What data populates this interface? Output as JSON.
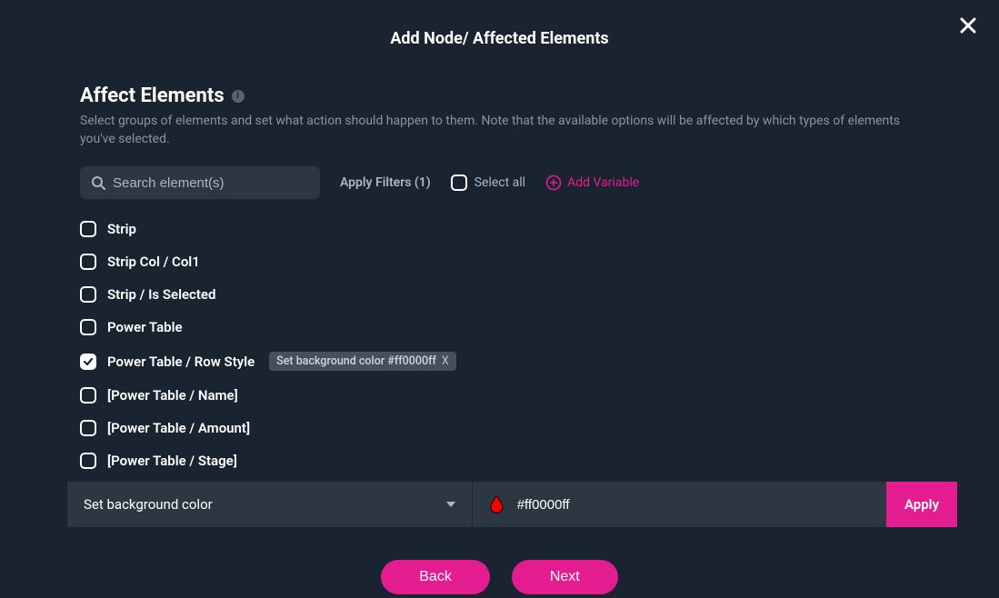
{
  "dialog": {
    "title": "Add Node/ Affected Elements"
  },
  "section": {
    "title": "Affect Elements",
    "desc": "Select groups of elements and set what action should happen to them. Note that the available options will be affected by which types of elements you've selected."
  },
  "toolbar": {
    "search_placeholder": "Search element(s)",
    "apply_filters": "Apply Filters (1)",
    "select_all": "Select all",
    "add_variable": "Add Variable"
  },
  "elements": [
    {
      "label": "Strip",
      "checked": false
    },
    {
      "label": "Strip Col / Col1",
      "checked": false
    },
    {
      "label": "Strip / Is Selected",
      "checked": false
    },
    {
      "label": "Power Table",
      "checked": false
    },
    {
      "label": "Power Table / Row Style",
      "checked": true,
      "tag": "Set background color #ff0000ff"
    },
    {
      "label": "[Power Table / Name]",
      "checked": false
    },
    {
      "label": "[Power Table / Amount]",
      "checked": false
    },
    {
      "label": "[Power Table / Stage]",
      "checked": false
    }
  ],
  "action": {
    "select_label": "Set background color",
    "color_value": "#ff0000ff",
    "apply_label": "Apply"
  },
  "footer": {
    "back": "Back",
    "next": "Next"
  },
  "tag_close": "X"
}
